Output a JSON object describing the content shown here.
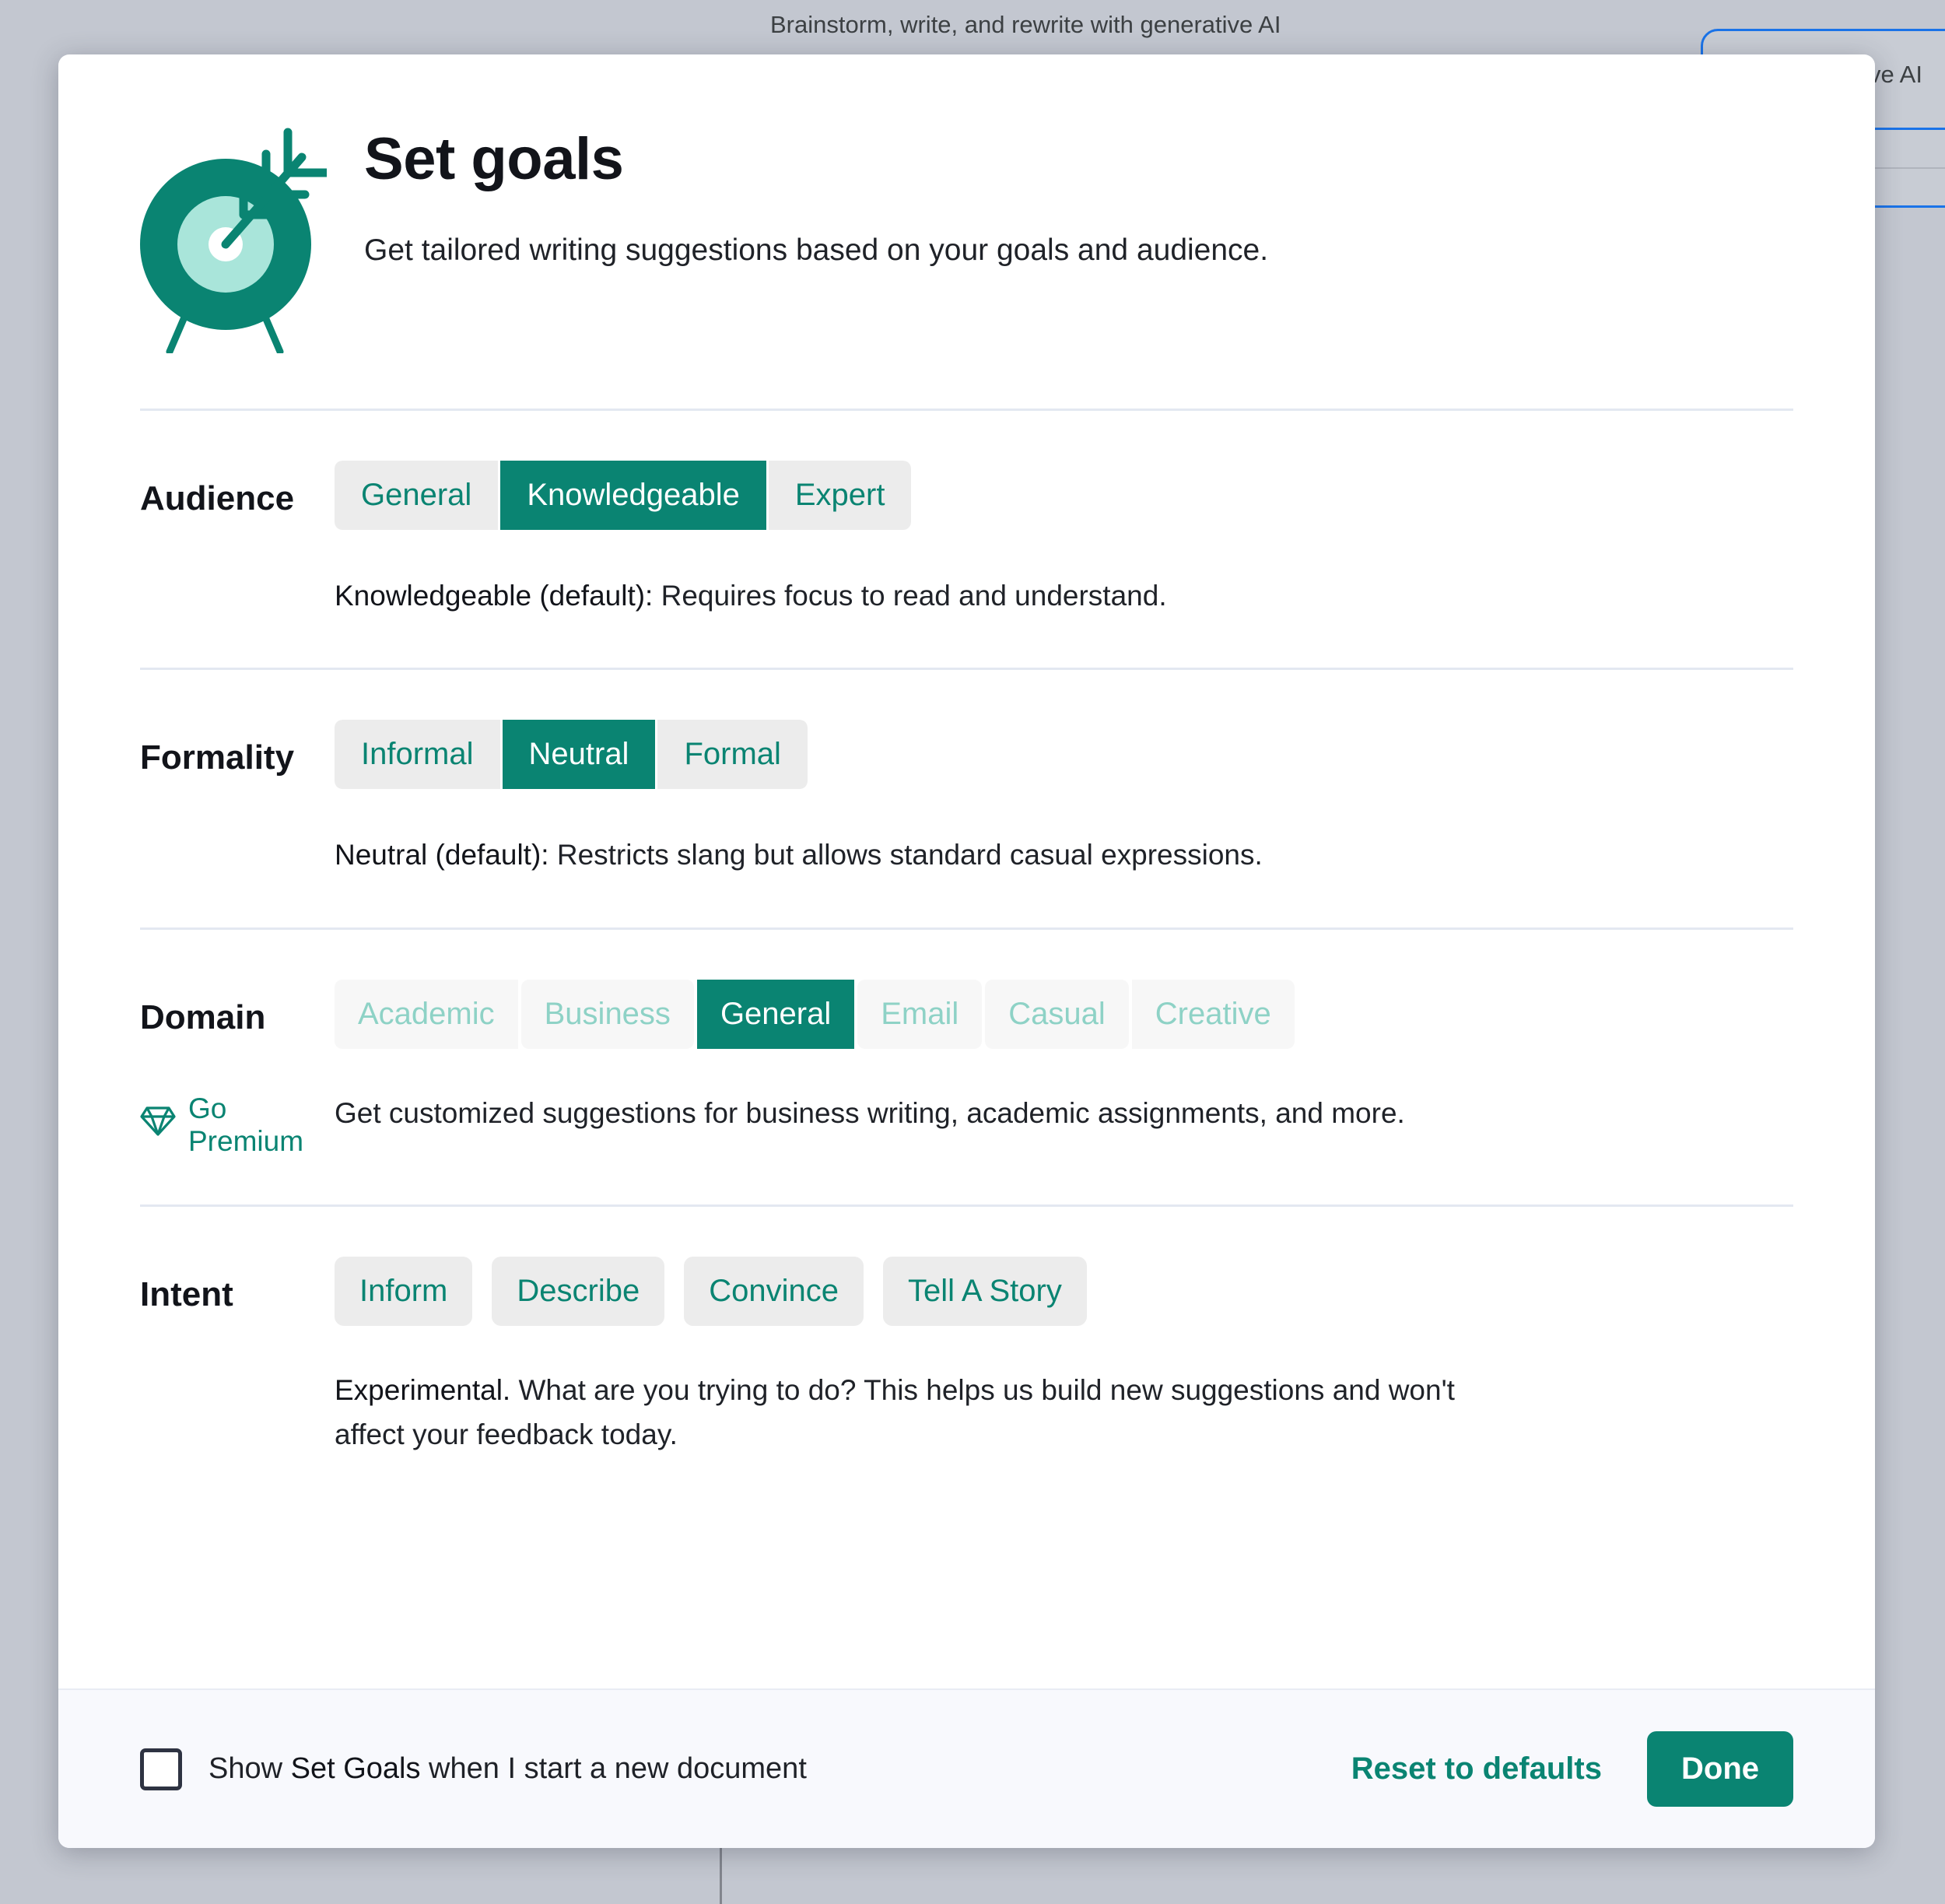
{
  "backdrop": {
    "toolbar_text": "Brainstorm, write, and rewrite with generative AI",
    "side_panel_text": "ve AI",
    "accent_blue": "#1a73e8",
    "chrome_color": "#c3c7d0"
  },
  "modal": {
    "title": "Set goals",
    "subtitle": "Get tailored writing suggestions based on your goals and audience.",
    "icon_name": "target-with-arrow-icon",
    "accent_color": "#0a8472",
    "accent_light": "#a9e5da",
    "disabled_text_color": "#8ed2c6"
  },
  "sections": {
    "audience": {
      "label": "Audience",
      "options": [
        "General",
        "Knowledgeable",
        "Expert"
      ],
      "selected": "Knowledgeable",
      "note_strong": "Knowledgeable (default):",
      "note_rest": " Requires focus to read and understand."
    },
    "formality": {
      "label": "Formality",
      "options": [
        "Informal",
        "Neutral",
        "Formal"
      ],
      "selected": "Neutral",
      "note_strong": "Neutral (default):",
      "note_rest": " Restricts slang but allows standard casual expressions."
    },
    "domain": {
      "label": "Domain",
      "options": [
        "Academic",
        "Business",
        "General",
        "Email",
        "Casual",
        "Creative"
      ],
      "selected": "General",
      "disabled": [
        "Academic",
        "Business",
        "Email",
        "Casual",
        "Creative"
      ],
      "premium_label": "Go Premium",
      "premium_icon": "gem-icon",
      "note": "Get customized suggestions for business writing, academic assignments, and more."
    },
    "intent": {
      "label": "Intent",
      "options": [
        "Inform",
        "Describe",
        "Convince",
        "Tell A Story"
      ],
      "selected": null,
      "note_strong": "Experimental.",
      "note_rest": " What are you trying to do? This helps us build new suggestions and won't affect your feedback today."
    }
  },
  "footer": {
    "checkbox_checked": false,
    "checkbox_label_pre": "Show ",
    "checkbox_label_strong": "Set Goals",
    "checkbox_label_post": " when I start a new document",
    "reset_label": "Reset to defaults",
    "done_label": "Done"
  }
}
